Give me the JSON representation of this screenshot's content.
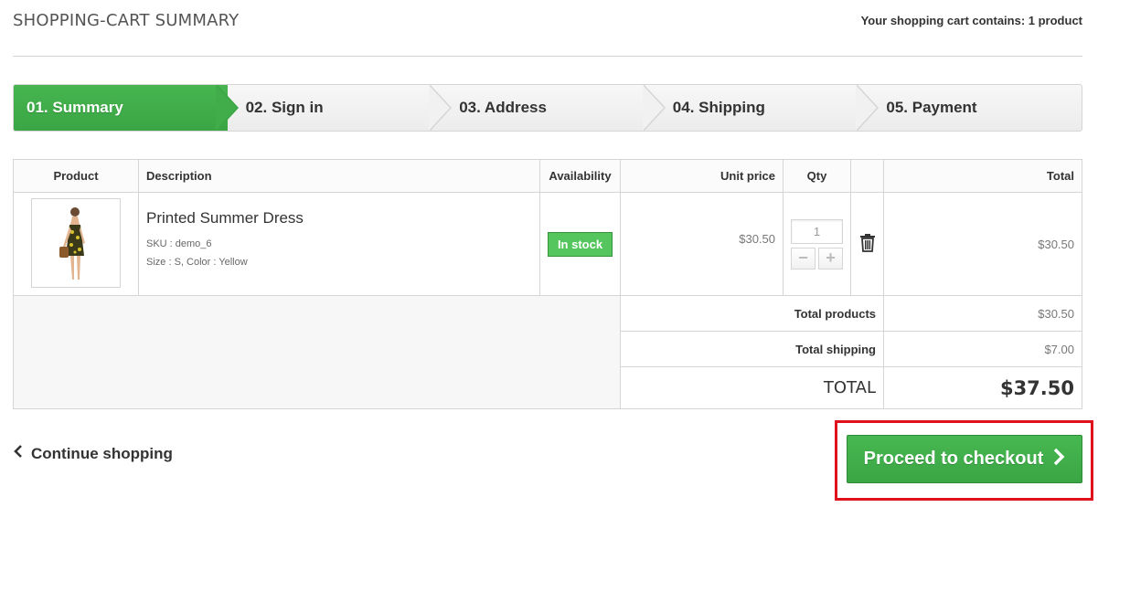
{
  "header": {
    "title": "SHOPPING-CART SUMMARY",
    "cart_count": "Your shopping cart contains: 1 product"
  },
  "steps": [
    {
      "label": "01. Summary",
      "active": true
    },
    {
      "label": "02. Sign in",
      "active": false
    },
    {
      "label": "03. Address",
      "active": false
    },
    {
      "label": "04. Shipping",
      "active": false
    },
    {
      "label": "05. Payment",
      "active": false
    }
  ],
  "table": {
    "columns": {
      "product": "Product",
      "description": "Description",
      "availability": "Availability",
      "unit_price": "Unit price",
      "qty": "Qty",
      "total": "Total"
    },
    "item": {
      "name": "Printed Summer Dress",
      "sku": "SKU : demo_6",
      "attributes": "Size : S, Color : Yellow",
      "availability": "In stock",
      "unit_price": "$30.50",
      "qty": "1",
      "qty_minus": "−",
      "qty_plus": "+",
      "total": "$30.50"
    },
    "summary": {
      "total_products_label": "Total products",
      "total_products": "$30.50",
      "total_shipping_label": "Total shipping",
      "total_shipping": "$7.00",
      "total_label": "TOTAL",
      "total": "$37.50"
    }
  },
  "actions": {
    "continue_label": "Continue shopping",
    "checkout_label": "Proceed to checkout"
  },
  "colors": {
    "accent_green": "#46b54f",
    "highlight_red": "#e0101f"
  }
}
